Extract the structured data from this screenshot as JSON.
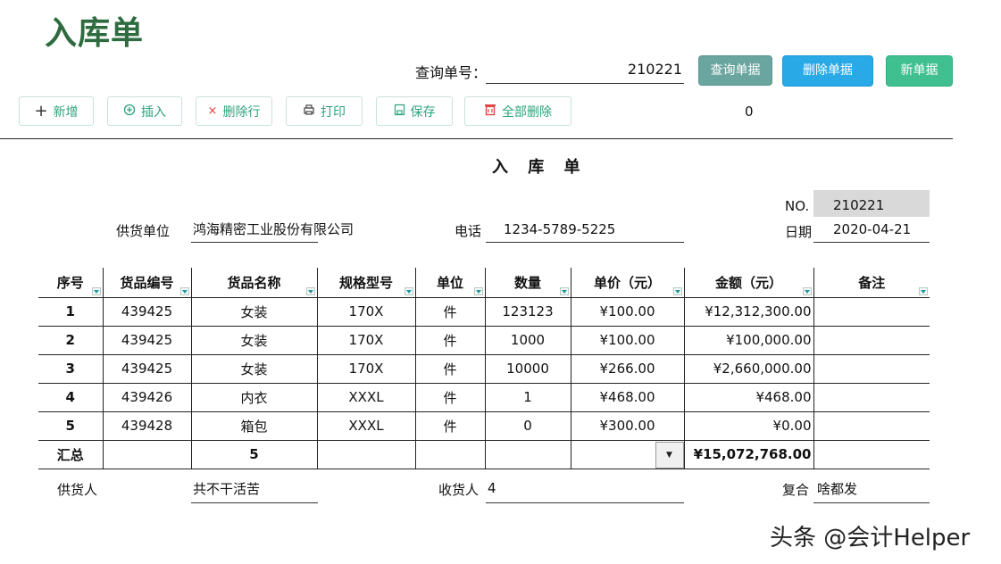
{
  "app": {
    "title": "入库单"
  },
  "query": {
    "label": "查询单号：",
    "value": "210221"
  },
  "top_buttons": {
    "query": "查询单据",
    "delete": "删除单据",
    "new": "新单据"
  },
  "toolbar": [
    {
      "label": "新增",
      "icon": "plus-icon"
    },
    {
      "label": "插入",
      "icon": "insert-icon"
    },
    {
      "label": "删除行",
      "icon": "close-icon"
    },
    {
      "label": "打印",
      "icon": "printer-icon"
    },
    {
      "label": "保存",
      "icon": "save-icon"
    },
    {
      "label": "全部删除",
      "icon": "trash-icon"
    }
  ],
  "counter": "0",
  "doc": {
    "title": "入 库 单",
    "no_label": "NO.",
    "no_value": "210221",
    "date_label": "日期",
    "date_value": "2020-04-21",
    "supplier_label": "供货单位",
    "supplier_value": "鸿海精密工业股份有限公司",
    "phone_label": "电话",
    "phone_value": "1234-5789-5225"
  },
  "table": {
    "headers": [
      "序号",
      "货品编号",
      "货品名称",
      "规格型号",
      "单位",
      "数量",
      "单价（元）",
      "金额（元）",
      "备注"
    ],
    "rows": [
      [
        "1",
        "439425",
        "女装",
        "170X",
        "件",
        "123123",
        "¥100.00",
        "¥12,312,300.00",
        ""
      ],
      [
        "2",
        "439425",
        "女装",
        "170X",
        "件",
        "1000",
        "¥100.00",
        "¥100,000.00",
        ""
      ],
      [
        "3",
        "439425",
        "女装",
        "170X",
        "件",
        "10000",
        "¥266.00",
        "¥2,660,000.00",
        ""
      ],
      [
        "4",
        "439426",
        "内衣",
        "XXXL",
        "件",
        "1",
        "¥468.00",
        "¥468.00",
        ""
      ],
      [
        "5",
        "439428",
        "箱包",
        "XXXL",
        "件",
        "0",
        "¥300.00",
        "¥0.00",
        ""
      ]
    ],
    "total": {
      "label": "汇总",
      "count": "5",
      "amount": "¥15,072,768.00"
    }
  },
  "footer": {
    "supplier_person_label": "供货人",
    "supplier_person_value": "共不干活苦",
    "receiver_label": "收货人",
    "receiver_value": "4",
    "reviewer_label": "复合",
    "reviewer_value": "啥都发"
  },
  "watermark": "头条 @会计Helper"
}
